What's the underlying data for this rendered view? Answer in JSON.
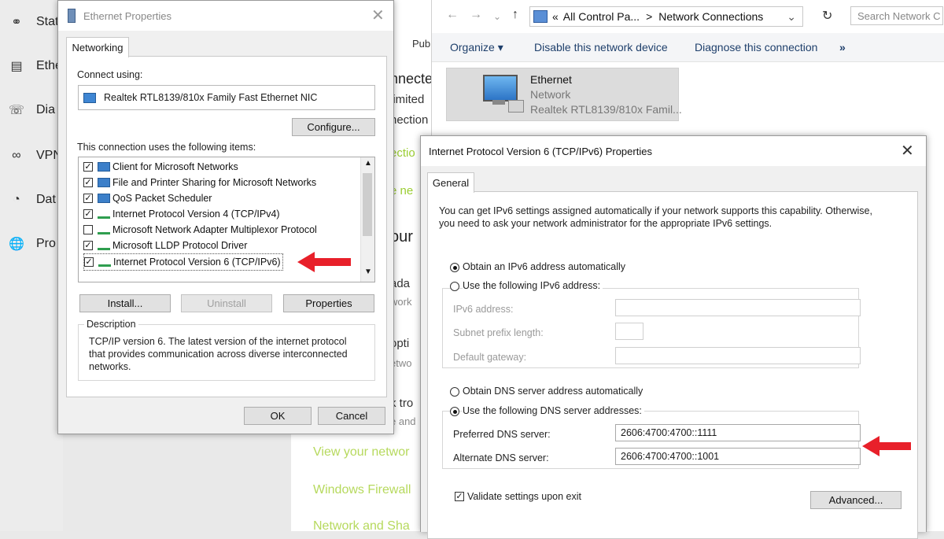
{
  "sidebar": {
    "items": [
      {
        "label": "Stat",
        "icon": "globe-status-icon"
      },
      {
        "label": "Ethe",
        "icon": "ethernet-icon"
      },
      {
        "label": "Dia",
        "icon": "dialup-icon"
      },
      {
        "label": "VPN",
        "icon": "vpn-icon"
      },
      {
        "label": "Dat",
        "icon": "data-usage-icon"
      },
      {
        "label": "Pro",
        "icon": "proxy-icon"
      }
    ]
  },
  "background": {
    "lines": [
      "Pub",
      "nnected",
      "limited",
      "nection",
      "ectio",
      "e ne",
      "our",
      "ada",
      "work",
      "opti",
      "etwo",
      "k tro",
      "e and"
    ],
    "related_links": [
      "View your networ",
      "Windows Firewall",
      "Network and Sha"
    ]
  },
  "explorer": {
    "breadcrumb_prefix": "«",
    "breadcrumb_parent": "All Control Pa...",
    "breadcrumb_sep": ">",
    "breadcrumb_current": "Network Connections",
    "search_placeholder": "Search Network C",
    "toolbar": {
      "organize": "Organize",
      "disable": "Disable this network device",
      "diagnose": "Diagnose this connection",
      "more": "»"
    },
    "connection": {
      "name": "Ethernet",
      "status": "Network",
      "device": "Realtek RTL8139/810x Famil..."
    }
  },
  "ethernet_dialog": {
    "title": "Ethernet Properties",
    "tab": "Networking",
    "connect_using_label": "Connect using:",
    "adapter": "Realtek RTL8139/810x Family Fast Ethernet NIC",
    "configure": "Configure...",
    "items_label": "This connection uses the following items:",
    "items": [
      {
        "label": "Client for Microsoft Networks",
        "checked": true
      },
      {
        "label": "File and Printer Sharing for Microsoft Networks",
        "checked": true
      },
      {
        "label": "QoS Packet Scheduler",
        "checked": true
      },
      {
        "label": "Internet Protocol Version 4 (TCP/IPv4)",
        "checked": true
      },
      {
        "label": "Microsoft Network Adapter Multiplexor Protocol",
        "checked": false
      },
      {
        "label": "Microsoft LLDP Protocol Driver",
        "checked": true
      },
      {
        "label": "Internet Protocol Version 6 (TCP/IPv6)",
        "checked": true
      }
    ],
    "install": "Install...",
    "uninstall": "Uninstall",
    "properties": "Properties",
    "description_label": "Description",
    "description": "TCP/IP version 6. The latest version of the internet protocol that provides communication across diverse interconnected networks.",
    "ok": "OK",
    "cancel": "Cancel"
  },
  "ipv6_dialog": {
    "title": "Internet Protocol Version 6 (TCP/IPv6) Properties",
    "tab": "General",
    "intro": "You can get IPv6 settings assigned automatically if your network supports this capability. Otherwise, you need to ask your network administrator for the appropriate IPv6 settings.",
    "obtain_auto": "Obtain an IPv6 address automatically",
    "use_following": "Use the following IPv6 address:",
    "ipv6_address": "IPv6 address:",
    "subnet_prefix": "Subnet prefix length:",
    "default_gateway": "Default gateway:",
    "dns_auto": "Obtain DNS server address automatically",
    "dns_manual": "Use the following DNS server addresses:",
    "preferred_label": "Preferred DNS server:",
    "preferred_value": "2606:4700:4700::1111",
    "alternate_label": "Alternate DNS server:",
    "alternate_value": "2606:4700:4700::1001",
    "validate": "Validate settings upon exit",
    "advanced": "Advanced..."
  },
  "colors": {
    "arrow": "#e8202a",
    "link_green": "#b6d95d",
    "toolbar_blue": "#1e3f6b"
  }
}
